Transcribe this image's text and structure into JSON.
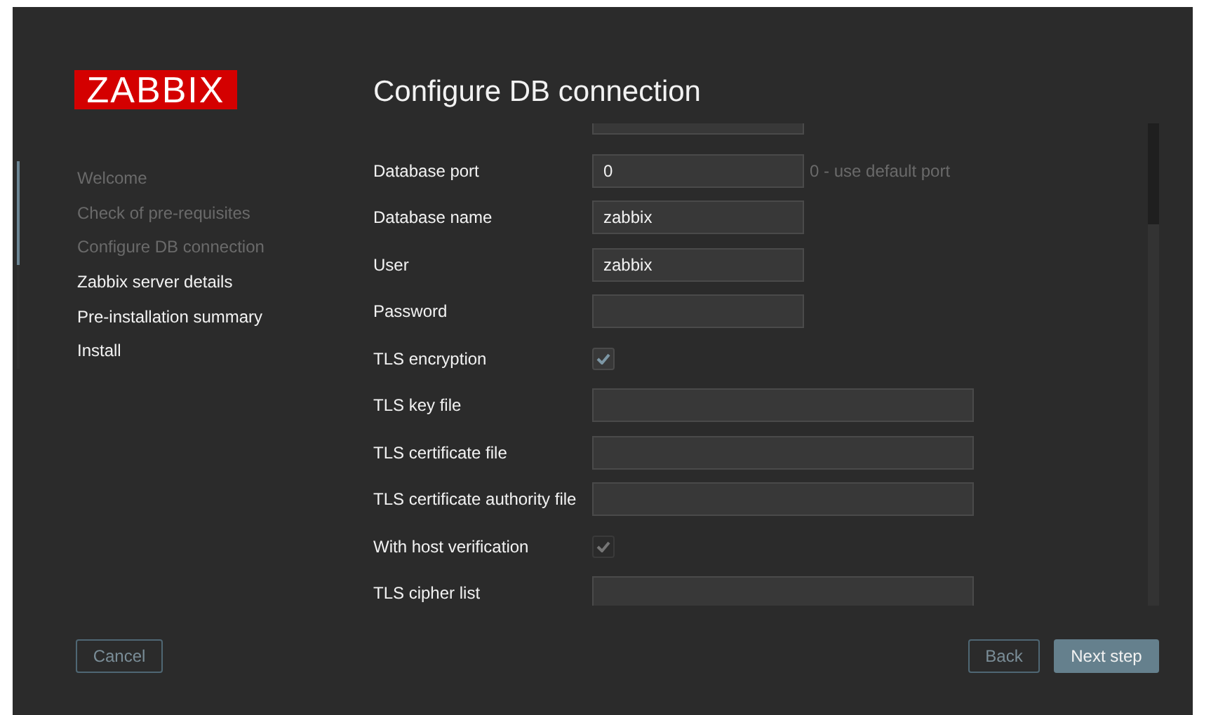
{
  "logo": "ZABBIX",
  "steps": [
    {
      "label": "Welcome",
      "completed": true
    },
    {
      "label": "Check of pre-requisites",
      "completed": true
    },
    {
      "label": "Configure DB connection",
      "completed": true
    },
    {
      "label": "Zabbix server details",
      "completed": false
    },
    {
      "label": "Pre-installation summary",
      "completed": false
    },
    {
      "label": "Install",
      "completed": false
    }
  ],
  "steps_progress": {
    "level": 0.5
  },
  "title": "Configure DB connection",
  "form": [
    {
      "kind": "text",
      "label": "Database port",
      "value": "0",
      "hint": "0 - use default port"
    },
    {
      "kind": "text",
      "label": "Database name",
      "value": "zabbix"
    },
    {
      "kind": "text",
      "label": "User",
      "value": "zabbix"
    },
    {
      "kind": "text",
      "label": "Password"
    },
    {
      "kind": "checkbox",
      "label": "TLS encryption",
      "checked": true,
      "disabled": false
    },
    {
      "kind": "wide",
      "label": "TLS key file"
    },
    {
      "kind": "wide",
      "label": "TLS certificate file"
    },
    {
      "kind": "wide",
      "label": "TLS certificate authority file"
    },
    {
      "kind": "checkbox",
      "label": "With host verification",
      "checked": true,
      "disabled": true
    },
    {
      "kind": "wide",
      "label": "TLS cipher list"
    }
  ],
  "buttons": {
    "cancel": "Cancel",
    "back": "Back",
    "next": "Next step"
  }
}
